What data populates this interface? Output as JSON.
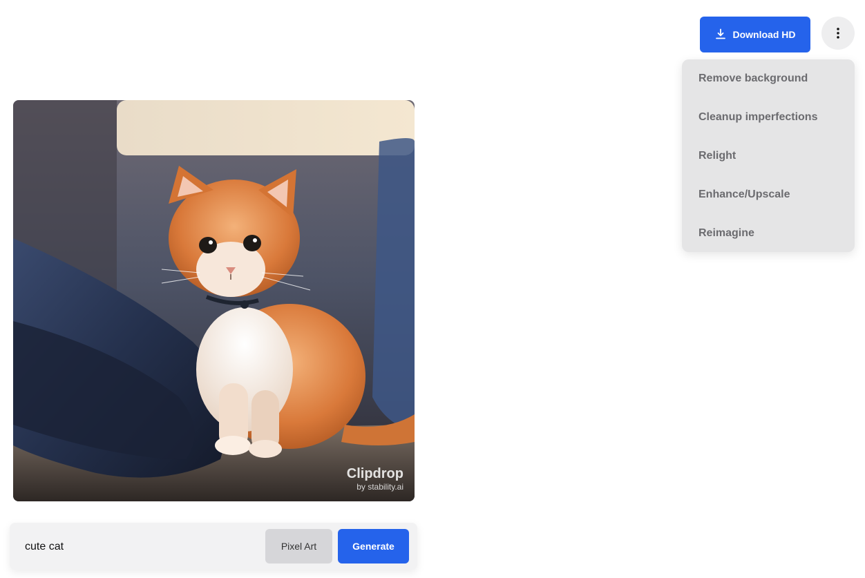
{
  "header": {
    "download_label": "Download HD"
  },
  "menu": {
    "items": [
      "Remove background",
      "Cleanup imperfections",
      "Relight",
      "Enhance/Upscale",
      "Reimagine"
    ]
  },
  "image": {
    "watermark_title": "Clipdrop",
    "watermark_sub": "by stability.ai"
  },
  "prompt": {
    "value": "cute cat",
    "style_label": "Pixel Art",
    "generate_label": "Generate"
  },
  "colors": {
    "accent": "#2563eb",
    "menu_bg": "#e5e5e6"
  }
}
